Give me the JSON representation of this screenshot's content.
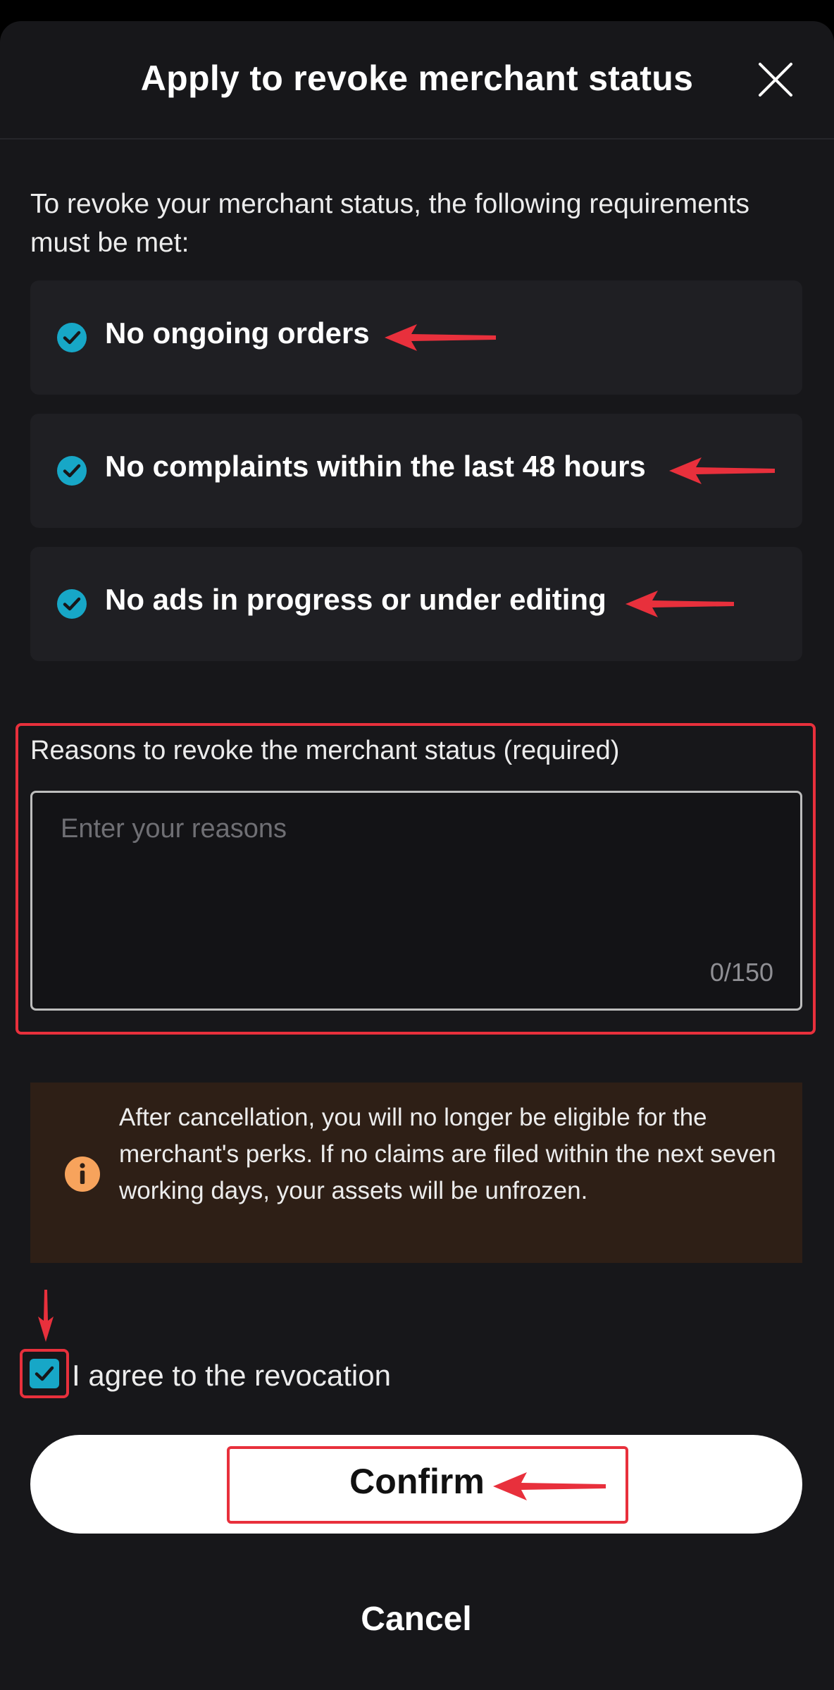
{
  "dialog": {
    "title": "Apply to revoke merchant status",
    "close_icon": "close-icon"
  },
  "intro": "To revoke your merchant status, the following requirements must be met:",
  "requirements": [
    {
      "label": "No ongoing orders",
      "icon": "check-circle-icon"
    },
    {
      "label": "No complaints within the last 48 hours",
      "icon": "check-circle-icon"
    },
    {
      "label": "No ads in progress or under editing",
      "icon": "check-circle-icon"
    }
  ],
  "reasons": {
    "label": "Reasons to revoke the merchant status (required)",
    "placeholder": "Enter your reasons",
    "value": "",
    "counter": "0/150"
  },
  "notice": {
    "icon": "info-icon",
    "text": "After cancellation, you will no longer be eligible for the merchant's perks. If no claims are filed within the next seven working days, your assets will be unfrozen."
  },
  "agree": {
    "label": "I agree to the revocation",
    "checked": true
  },
  "buttons": {
    "confirm": "Confirm",
    "cancel": "Cancel"
  },
  "colors": {
    "accent": "#17a7c7",
    "annotation_red": "#e8303c",
    "sheet_bg": "#17171a",
    "notice_bg": "#2e1f16",
    "info_orange": "#f7a35c"
  }
}
